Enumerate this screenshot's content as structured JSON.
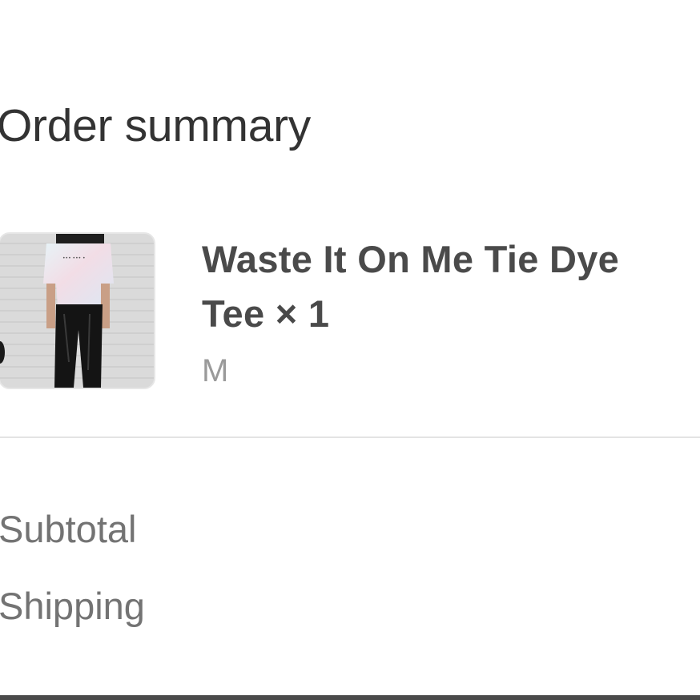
{
  "order_summary": {
    "title": "Order summary",
    "item": {
      "name": "Waste It On Me Tie Dye Tee × 1",
      "variant": "M",
      "image_icon": "product-photo"
    },
    "rows": [
      {
        "label": "Subtotal"
      },
      {
        "label": "Shipping"
      }
    ]
  }
}
